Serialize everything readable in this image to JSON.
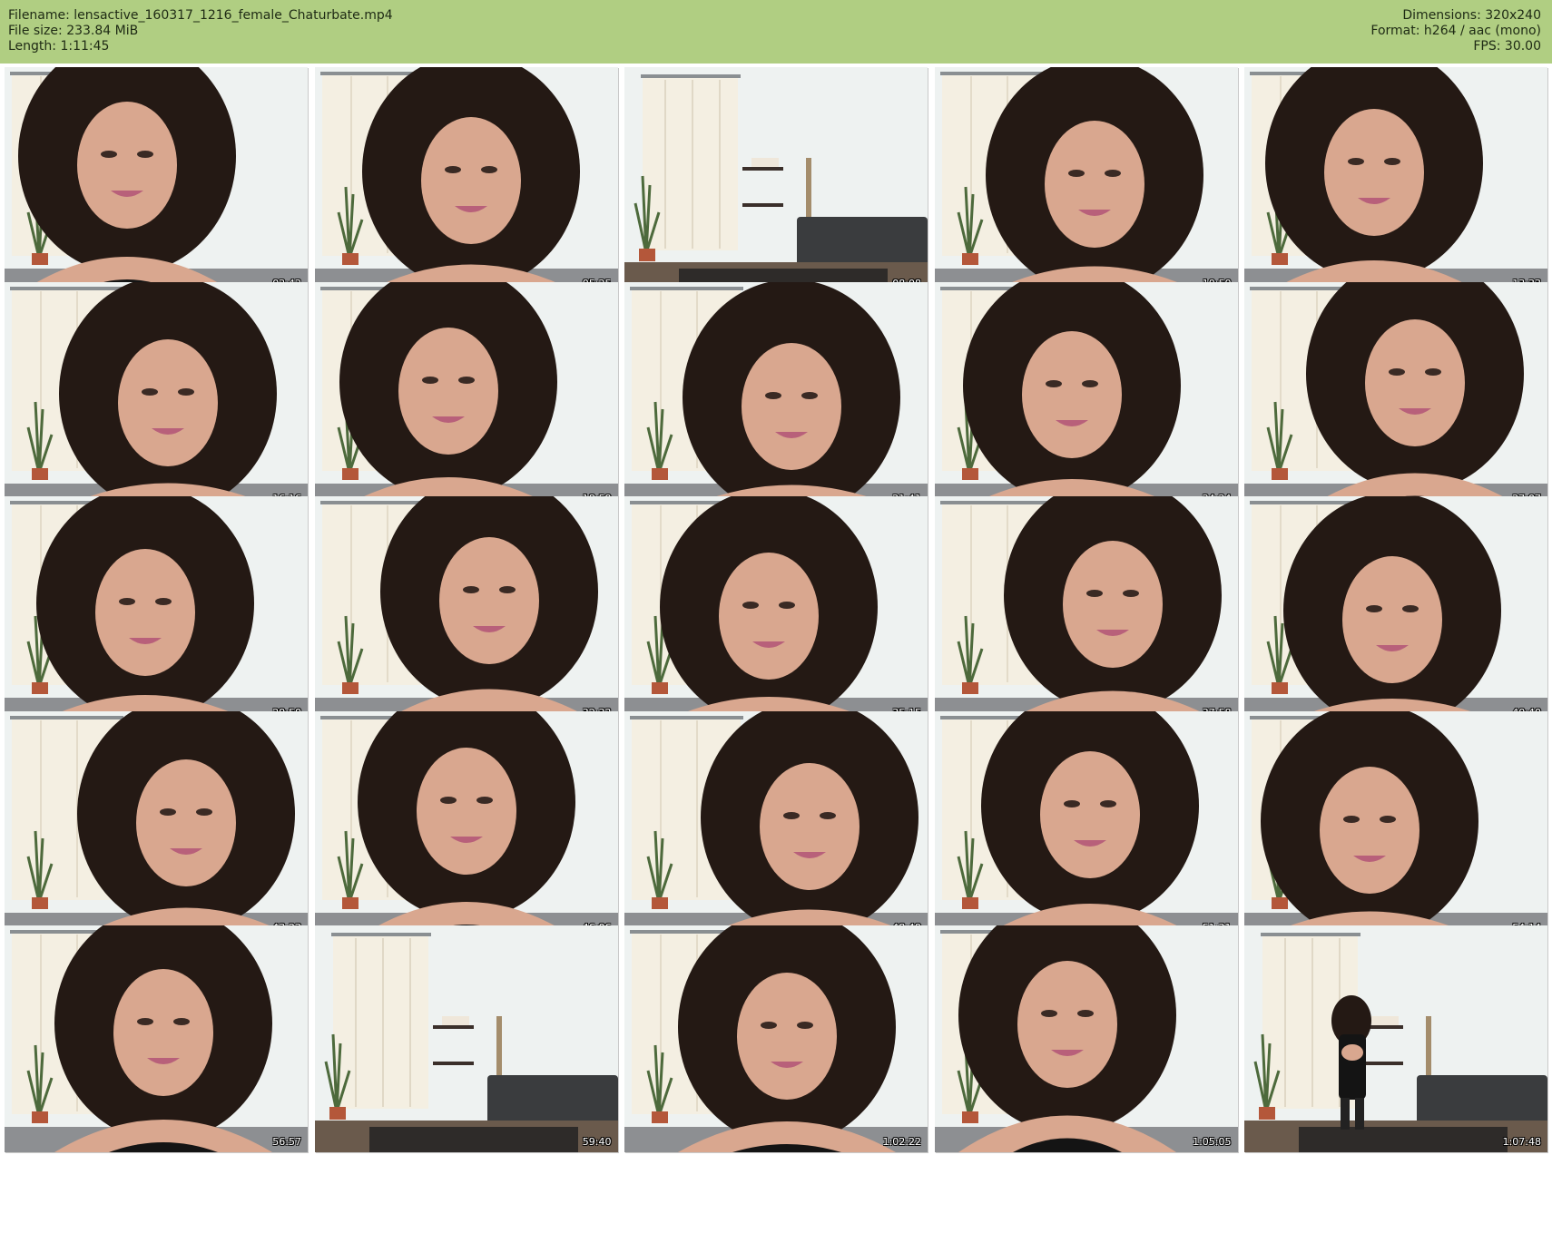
{
  "header": {
    "filename_line": "Filename: lensactive_160317_1216_female_Chaturbate.mp4",
    "filesize_line": "File size: 233.84 MiB",
    "length_line": "Length: 1:11:45",
    "dimensions_line": "Dimensions: 320x240",
    "format_line": "Format: h264 / aac (mono)",
    "fps_line": "FPS: 30.00"
  },
  "colors": {
    "header_bg": "#b0ce82",
    "header_text": "#1e2a14",
    "wall": "#eef2f1",
    "curtain": "#f4efe2",
    "floor": "#6a5a4c",
    "sofa": "#3a3c3e",
    "hair": "#241914",
    "skin": "#d9a78f",
    "top": "#141414"
  },
  "thumbnails": [
    {
      "time": "02:42",
      "scene": "person"
    },
    {
      "time": "05:25",
      "scene": "person"
    },
    {
      "time": "08:08",
      "scene": "room"
    },
    {
      "time": "10:50",
      "scene": "person"
    },
    {
      "time": "13:33",
      "scene": "person"
    },
    {
      "time": "16:16",
      "scene": "person"
    },
    {
      "time": "18:59",
      "scene": "person"
    },
    {
      "time": "21:41",
      "scene": "person"
    },
    {
      "time": "24:24",
      "scene": "person"
    },
    {
      "time": "27:07",
      "scene": "person"
    },
    {
      "time": "29:50",
      "scene": "person"
    },
    {
      "time": "32:32",
      "scene": "person"
    },
    {
      "time": "35:15",
      "scene": "person"
    },
    {
      "time": "37:58",
      "scene": "person"
    },
    {
      "time": "40:40",
      "scene": "person"
    },
    {
      "time": "43:23",
      "scene": "person"
    },
    {
      "time": "46:06",
      "scene": "person"
    },
    {
      "time": "48:49",
      "scene": "person"
    },
    {
      "time": "51:31",
      "scene": "person"
    },
    {
      "time": "54:14",
      "scene": "person"
    },
    {
      "time": "56:57",
      "scene": "person"
    },
    {
      "time": "59:40",
      "scene": "room"
    },
    {
      "time": "1:02:22",
      "scene": "person"
    },
    {
      "time": "1:05:05",
      "scene": "person"
    },
    {
      "time": "1:07:48",
      "scene": "room-person"
    }
  ]
}
